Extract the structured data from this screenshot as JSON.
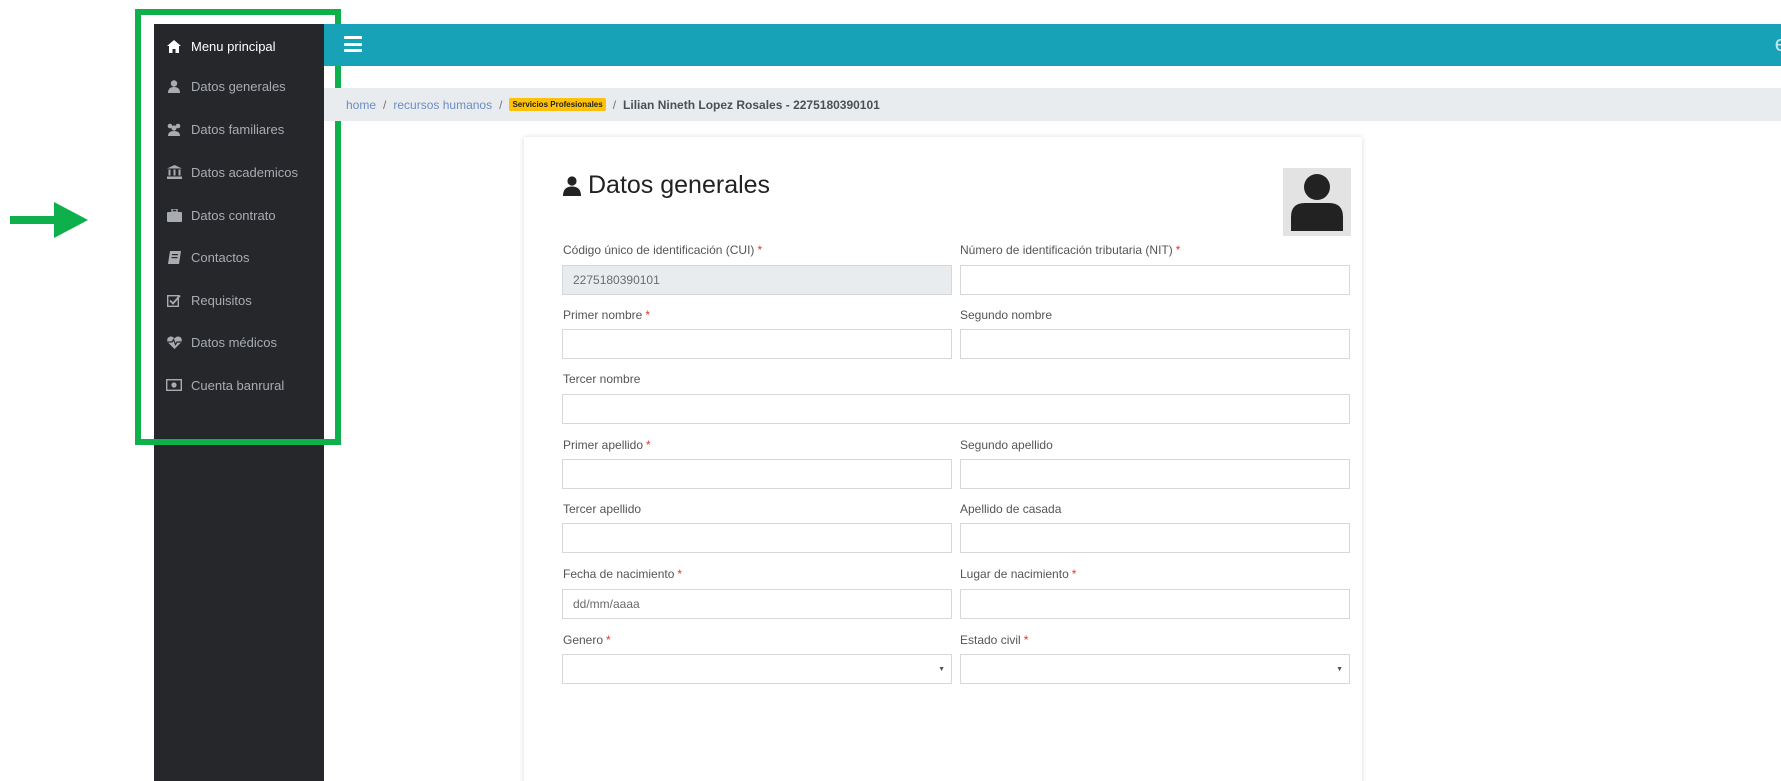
{
  "colors": {
    "sidebar": "#25272b",
    "topbar": "#17a2b8",
    "highlight": "#0db04b",
    "badge": "#ffc107",
    "required": "#e3342f"
  },
  "sidebar": {
    "items": [
      {
        "label": "Menu principal",
        "icon": "home-icon"
      },
      {
        "label": "Datos generales",
        "icon": "user-icon"
      },
      {
        "label": "Datos familiares",
        "icon": "users-icon"
      },
      {
        "label": "Datos academicos",
        "icon": "university-icon"
      },
      {
        "label": "Datos contrato",
        "icon": "briefcase-icon"
      },
      {
        "label": "Contactos",
        "icon": "address-book-icon"
      },
      {
        "label": "Requisitos",
        "icon": "check-square-icon"
      },
      {
        "label": "Datos médicos",
        "icon": "heartbeat-icon"
      },
      {
        "label": "Cuenta banrural",
        "icon": "money-icon"
      }
    ]
  },
  "topbar": {
    "menu_icon": "hamburger-icon",
    "user_glyph": "e"
  },
  "breadcrumb": {
    "home": "home",
    "separator": "/",
    "section": "recursos humanos",
    "badge": "Servicios Profesionales",
    "current": "Lilian Nineth Lopez Rosales - 2275180390101"
  },
  "form": {
    "title": "Datos generales",
    "title_icon": "user-icon",
    "avatar_icon": "avatar-icon",
    "required_mark": "*",
    "fields": {
      "cui": {
        "label": "Código único de identificación (CUI)",
        "value": "2275180390101"
      },
      "nit": {
        "label": "Número de identificación tributaria (NIT)",
        "value": ""
      },
      "primer_nombre": {
        "label": "Primer nombre",
        "value": ""
      },
      "segundo_nombre": {
        "label": "Segundo nombre",
        "value": ""
      },
      "tercer_nombre": {
        "label": "Tercer nombre",
        "value": ""
      },
      "primer_apellido": {
        "label": "Primer apellido",
        "value": ""
      },
      "segundo_apellido": {
        "label": "Segundo apellido",
        "value": ""
      },
      "tercer_apellido": {
        "label": "Tercer apellido",
        "value": ""
      },
      "apellido_casada": {
        "label": "Apellido de casada",
        "value": ""
      },
      "fecha_nacimiento": {
        "label": "Fecha de nacimiento",
        "value": "dd/mm/aaaa"
      },
      "lugar_nacimiento": {
        "label": "Lugar de nacimiento",
        "value": ""
      },
      "genero": {
        "label": "Genero",
        "value": ""
      },
      "estado_civil": {
        "label": "Estado civil",
        "value": ""
      }
    }
  }
}
